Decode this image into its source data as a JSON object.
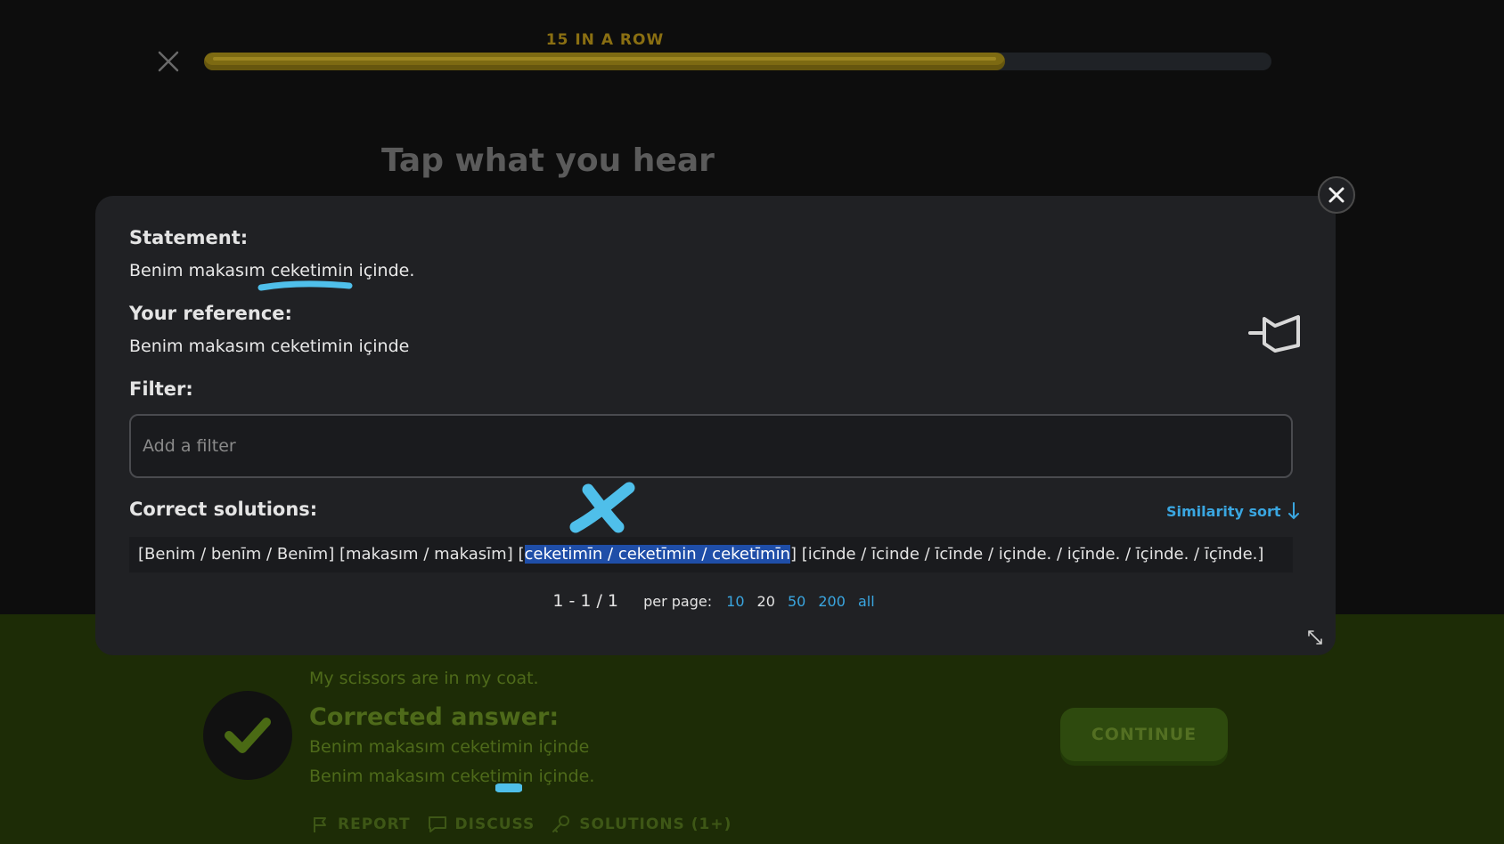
{
  "lesson": {
    "streak_label": "15 IN A ROW",
    "progress_fraction": 0.75,
    "heading": "Tap what you hear",
    "meaning_text": "My scissors are in my coat.",
    "corrected_title": "Corrected answer:",
    "corrected_line1": "Benim makasım ceketimin içinde",
    "corrected_line2": "Benim makasım ceketimin içinde.",
    "continue_label": "CONTINUE",
    "actions": {
      "report": "REPORT",
      "discuss": "DISCUSS",
      "solutions": "SOLUTIONS (1+)"
    }
  },
  "modal": {
    "statement_label": "Statement:",
    "statement_pre": "Benim makasım ",
    "statement_word": "ceketimin",
    "statement_post": " içinde.",
    "reference_label": "Your reference:",
    "reference_text": "Benim makasım ceketimin içinde",
    "filter_label": "Filter:",
    "filter_placeholder": "Add a filter",
    "filter_value": "",
    "solutions_label": "Correct solutions:",
    "sort_label": "Similarity sort",
    "solution_pre": "[Benim / benīm / Benīm] [makasım / makasīm] [",
    "solution_selected": "ceketimīn / ceketīmin / ceketīmīn",
    "solution_post": "] [icīnde / īcinde / īcīnde / içinde. / içīnde. / īçinde. / īçīnde.]",
    "pager_range": "1 - 1 / 1",
    "per_page_label": "per page:",
    "per_page_options": [
      "10",
      "20",
      "50",
      "200",
      "all"
    ],
    "per_page_selected": "20"
  },
  "colors": {
    "accent_blue": "#3aa6e0",
    "selection": "#1f4ea8",
    "streak_gold": "#8a6f12",
    "footer_green": "#1d2c06"
  }
}
